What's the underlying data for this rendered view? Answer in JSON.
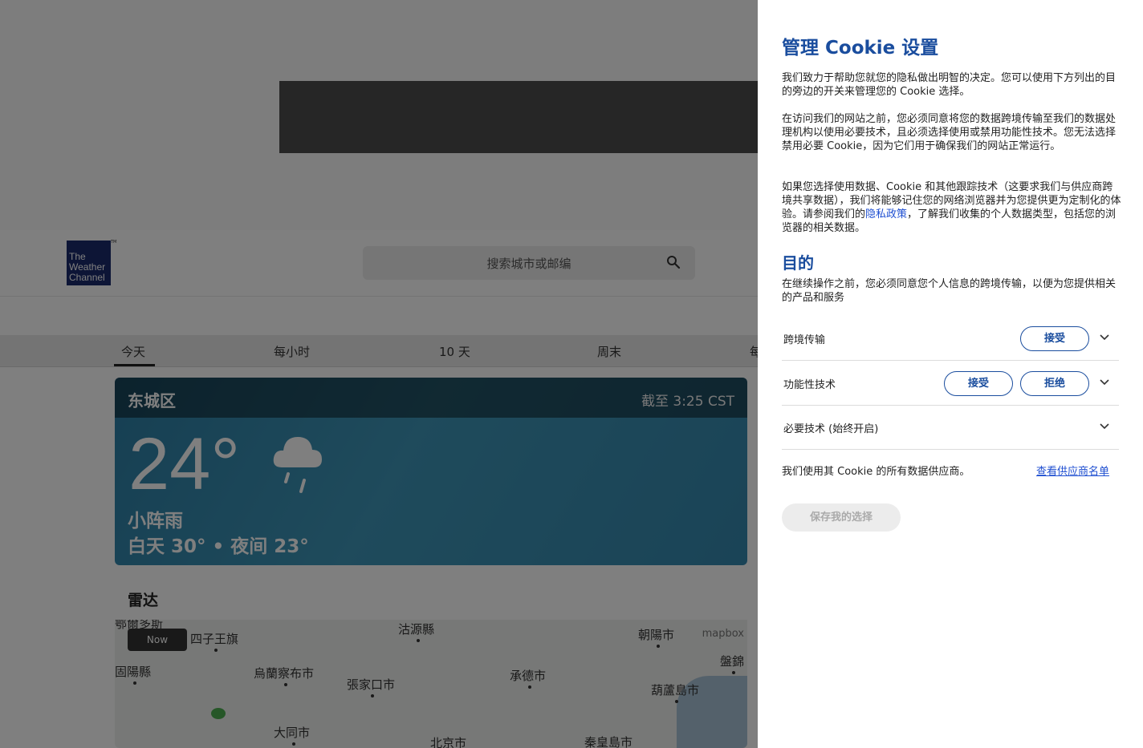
{
  "background": {
    "logo": {
      "lines": [
        "The",
        "Weather",
        "Channel"
      ],
      "tm": "TM"
    },
    "search": {
      "placeholder": "搜索城市或邮编"
    },
    "tabs": [
      {
        "label": "今天"
      },
      {
        "label": "每小时"
      },
      {
        "label": "10 天"
      },
      {
        "label": "周末"
      },
      {
        "label": "每"
      }
    ],
    "weather_card": {
      "location": "东城区",
      "as_of": "截至 3:25 CST",
      "temperature": "24°",
      "condition": "小阵雨",
      "day_night": "白天 30° • 夜间 23°"
    },
    "radar": {
      "title": "雷达",
      "now_label": "Now",
      "attribution": "mapbox",
      "cities": [
        "四子王旗",
        "沽源縣",
        "朝陽市",
        "盤錦",
        "烏蘭察布市",
        "張家口市",
        "承德市",
        "葫蘆島市",
        "大同市",
        "北京市",
        "秦皇島市",
        "固陽縣",
        "鄂爾多斯"
      ]
    }
  },
  "cookie_panel": {
    "title": "管理 Cookie 设置",
    "intro": "我们致力于帮助您就您的隐私做出明智的决定。您可以使用下方列出的目的旁边的开关来管理您的 Cookie 选择。",
    "para2": "在访问我们的网站之前，您必须同意将您的数据跨境传输至我们的数据处理机构以使用必要技术，且必须选择使用或禁用功能性技术。您无法选择禁用必要 Cookie，因为它们用于确保我们的网站正常运行。",
    "para3_before": "如果您选择使用数据、Cookie 和其他跟踪技术（这要求我们与供应商跨境共享数据），我们将能够记住您的网络浏览器并为您提供更为定制化的体验。请参阅我们的",
    "para3_link": "隐私政策",
    "para3_after": "，了解我们收集的个人数据类型，包括您的浏览器的相关数据。",
    "purpose_heading": "目的",
    "purpose_desc": "在继续操作之前，您必须同意您个人信息的跨境传输，以便为您提供相关的产品和服务",
    "rows": [
      {
        "label": "跨境传输",
        "accept": "接受"
      },
      {
        "label": "功能性技术",
        "accept": "接受",
        "reject": "拒绝"
      },
      {
        "label": "必要技术 (始终开启)"
      }
    ],
    "vendor_text": "我们使用其 Cookie 的所有数据供应商。",
    "vendor_link": "查看供应商名单",
    "save_button": "保存我的选择",
    "accent_color": "#1a4d9e"
  }
}
